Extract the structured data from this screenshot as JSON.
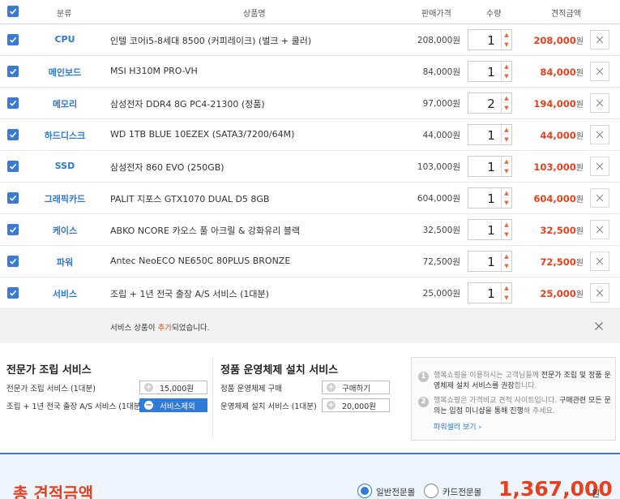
{
  "header": {
    "category": "분류",
    "product": "상품명",
    "price": "판매가격",
    "qty": "수량",
    "total": "견적금액"
  },
  "rows": [
    {
      "category": "CPU",
      "name": "인텔 코어i5-8세대 8500 (커피레이크) (벌크 + 쿨러)",
      "price": "208,000원",
      "qty": "1",
      "total": "208,000",
      "won": "원"
    },
    {
      "category": "메인보드",
      "name": "MSI H310M PRO-VH",
      "price": "84,000원",
      "qty": "1",
      "total": "84,000",
      "won": "원"
    },
    {
      "category": "메모리",
      "name": "삼성전자 DDR4 8G PC4-21300 (정품)",
      "price": "97,000원",
      "qty": "2",
      "total": "194,000",
      "won": "원"
    },
    {
      "category": "하드디스크",
      "name": "WD 1TB BLUE 10EZEX (SATA3/7200/64M)",
      "price": "44,000원",
      "qty": "1",
      "total": "44,000",
      "won": "원"
    },
    {
      "category": "SSD",
      "name": "삼성전자 860 EVO (250GB)",
      "price": "103,000원",
      "qty": "1",
      "total": "103,000",
      "won": "원"
    },
    {
      "category": "그래픽카드",
      "name": "PALIT 지포스 GTX1070 DUAL D5 8GB",
      "price": "604,000원",
      "qty": "1",
      "total": "604,000",
      "won": "원"
    },
    {
      "category": "케이스",
      "name": "ABKO NCORE 카오스 풀 아크릴 & 강화유리 블랙",
      "price": "32,500원",
      "qty": "1",
      "total": "32,500",
      "won": "원"
    },
    {
      "category": "파워",
      "name": "Antec NeoECO NE650C 80PLUS BRONZE",
      "price": "72,500원",
      "qty": "1",
      "total": "72,500",
      "won": "원"
    },
    {
      "category": "서비스",
      "name": "조립 + 1년 전국 출장 A/S 서비스 (1대분)",
      "price": "25,000원",
      "qty": "1",
      "total": "25,000",
      "won": "원"
    }
  ],
  "notice": {
    "prefix": "서비스 상품이 ",
    "highlight": "추가",
    "suffix": "되었습니다."
  },
  "assembly": {
    "title": "전문가 조립 서비스",
    "line1": "전문가 조립 서비스 (1대분)",
    "line1_btn": "15,000원",
    "line2": "조립 + 1년 전국 출장 A/S 서비스 (1대분)",
    "line2_btn": "서비스제외"
  },
  "os": {
    "title": "정품 운영체제 설치 서비스",
    "line1": "정품 운영체제 구매",
    "line1_btn": "구매하기",
    "line2": "운영체제 설치 서비스 (1대분)",
    "line2_btn": "20,000원"
  },
  "info": {
    "n1": "1",
    "t1a": "행복쇼핑을 이용하시는 고객님들께 ",
    "t1b": "전문가 조립 및 정품 운영체제 설치 서비스를 권장",
    "t1c": "합니다.",
    "n2": "2",
    "t2a": "행복쇼핑은 가격비교 견적 사이트입니다. ",
    "t2b": "구매관련 모든 문의는 입점 미니샵을 통해 진행",
    "t2c": "해 주세요.",
    "link": "파워셀러 보기 ›"
  },
  "footer": {
    "label": "총 견적금액",
    "radio1": "일반전문몰",
    "radio2": "카드전문몰",
    "grand_total": "1,367,000",
    "won": "원"
  },
  "colors": {
    "accent": "#3a7ad6",
    "price_red": "#e8401c"
  }
}
